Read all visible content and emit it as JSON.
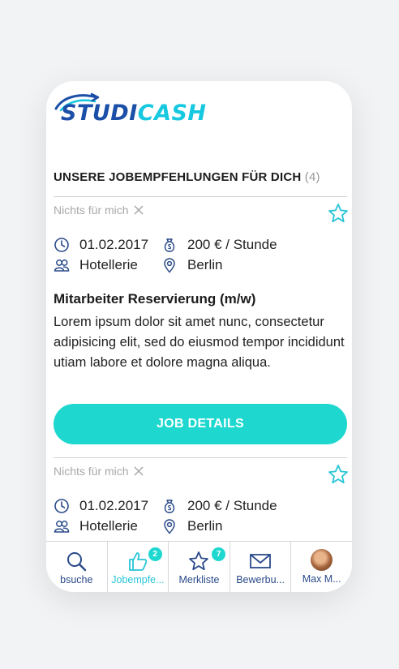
{
  "brand": {
    "logo_part1": "STUDI",
    "logo_part2": "CASH"
  },
  "section": {
    "title": "UNSERE JOBEMPFEHLUNGEN FÜR DICH",
    "count": "(4)"
  },
  "cards": [
    {
      "dismiss_label": "Nichts für mich",
      "date": "01.02.2017",
      "pay": "200 € / Stunde",
      "category": "Hotellerie",
      "location": "Berlin",
      "title": "Mitarbeiter Reservierung (m/w)",
      "description": "Lorem ipsum dolor sit amet nunc, consectetur adipisicing elit, sed do eiusmod tempor incididunt utiam labore et dolore magna aliqua.",
      "button_label": "JOB DETAILS"
    },
    {
      "dismiss_label": "Nichts für mich",
      "date": "01.02.2017",
      "pay": "200 € / Stunde",
      "category": "Hotellerie",
      "location": "Berlin"
    }
  ],
  "tabbar": {
    "tabs": [
      {
        "label": "bsuche",
        "icon": "search-icon"
      },
      {
        "label": "Jobempfe...",
        "icon": "thumbs-up-icon",
        "badge": "2",
        "active": true
      },
      {
        "label": "Merkliste",
        "icon": "star-icon",
        "badge": "7"
      },
      {
        "label": "Bewerbu...",
        "icon": "envelope-icon"
      },
      {
        "label": "Max M...",
        "icon": "avatar"
      }
    ]
  },
  "colors": {
    "accent": "#1ed8d0",
    "brand_blue": "#1b4fa8",
    "brand_cyan": "#16c8e0",
    "label_blue": "#2a4a8a"
  }
}
